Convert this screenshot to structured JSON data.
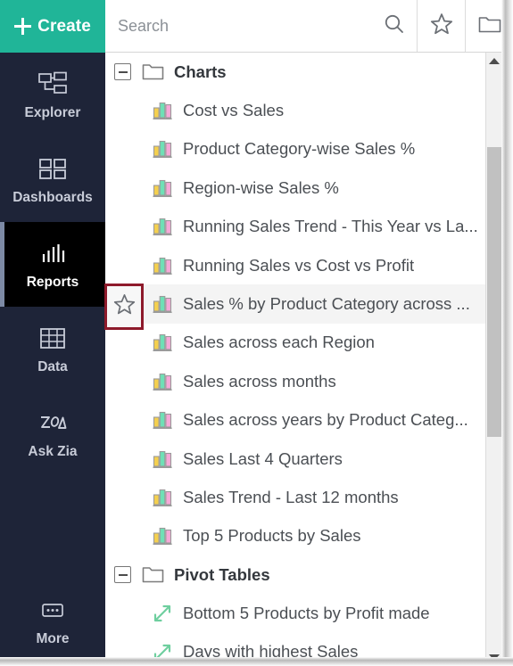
{
  "colors": {
    "create_button": "#20b598",
    "sidebar": "#1e2438",
    "active_nav": "#000000",
    "annotation": "#8e1a2b",
    "chart_icon_bar1": "#f5d04e",
    "chart_icon_bar2": "#6fe0b6",
    "chart_icon_bar3": "#f7a8d8",
    "pivot_icon": "#8ef0c4"
  },
  "create": {
    "label": "Create",
    "icon": "plus-icon"
  },
  "sidebar": {
    "items": [
      {
        "label": "Explorer",
        "icon": "explorer-tree-icon",
        "active": false
      },
      {
        "label": "Dashboards",
        "icon": "dashboards-grid-icon",
        "active": false
      },
      {
        "label": "Reports",
        "icon": "reports-bars-icon",
        "active": true
      },
      {
        "label": "Data",
        "icon": "data-table-icon",
        "active": false
      },
      {
        "label": "Ask Zia",
        "icon": "ask-zia-icon",
        "active": false
      },
      {
        "label": "More",
        "icon": "more-ellipsis-icon",
        "active": false
      }
    ]
  },
  "topbar": {
    "search": {
      "value": "",
      "placeholder": "Search"
    },
    "buttons": [
      {
        "name": "search-icon",
        "label": "Search"
      },
      {
        "name": "favorites-star-icon",
        "label": "Favorites"
      },
      {
        "name": "folder-icon",
        "label": "Folders"
      }
    ]
  },
  "tree": {
    "groups": [
      {
        "label": "Charts",
        "icon": "folder-icon",
        "expanded": true,
        "toggle": "collapse-minus-icon",
        "items": [
          {
            "label": "Cost vs Sales",
            "icon": "bar-chart-icon",
            "hovered": false
          },
          {
            "label": "Product Category-wise Sales %",
            "icon": "bar-chart-icon",
            "hovered": false
          },
          {
            "label": "Region-wise Sales %",
            "icon": "bar-chart-icon",
            "hovered": false
          },
          {
            "label": "Running Sales Trend - This Year vs La...",
            "icon": "bar-chart-icon",
            "hovered": false
          },
          {
            "label": "Running Sales vs Cost vs Profit",
            "icon": "bar-chart-icon",
            "hovered": false
          },
          {
            "label": "Sales % by Product Category across ...",
            "icon": "bar-chart-icon",
            "hovered": true
          },
          {
            "label": "Sales across each Region",
            "icon": "bar-chart-icon",
            "hovered": false
          },
          {
            "label": "Sales across months",
            "icon": "bar-chart-icon",
            "hovered": false
          },
          {
            "label": "Sales across years by Product Categ...",
            "icon": "bar-chart-icon",
            "hovered": false
          },
          {
            "label": "Sales Last 4 Quarters",
            "icon": "bar-chart-icon",
            "hovered": false
          },
          {
            "label": "Sales Trend - Last 12 months",
            "icon": "bar-chart-icon",
            "hovered": false
          },
          {
            "label": "Top 5 Products by Sales",
            "icon": "bar-chart-icon",
            "hovered": false
          }
        ]
      },
      {
        "label": "Pivot Tables",
        "icon": "folder-icon",
        "expanded": true,
        "toggle": "collapse-minus-icon",
        "items": [
          {
            "label": "Bottom 5 Products by Profit made",
            "icon": "pivot-table-icon",
            "hovered": false
          },
          {
            "label": "Days with highest Sales",
            "icon": "pivot-table-icon",
            "hovered": false
          }
        ]
      }
    ]
  },
  "annotation": {
    "target": "favorite-star-toggle",
    "icon": "star-outline-icon"
  },
  "scrollbar": {
    "up_icon": "triangle-up-icon",
    "down_icon": "triangle-down-icon",
    "thumb": "scrollbar-thumb"
  }
}
